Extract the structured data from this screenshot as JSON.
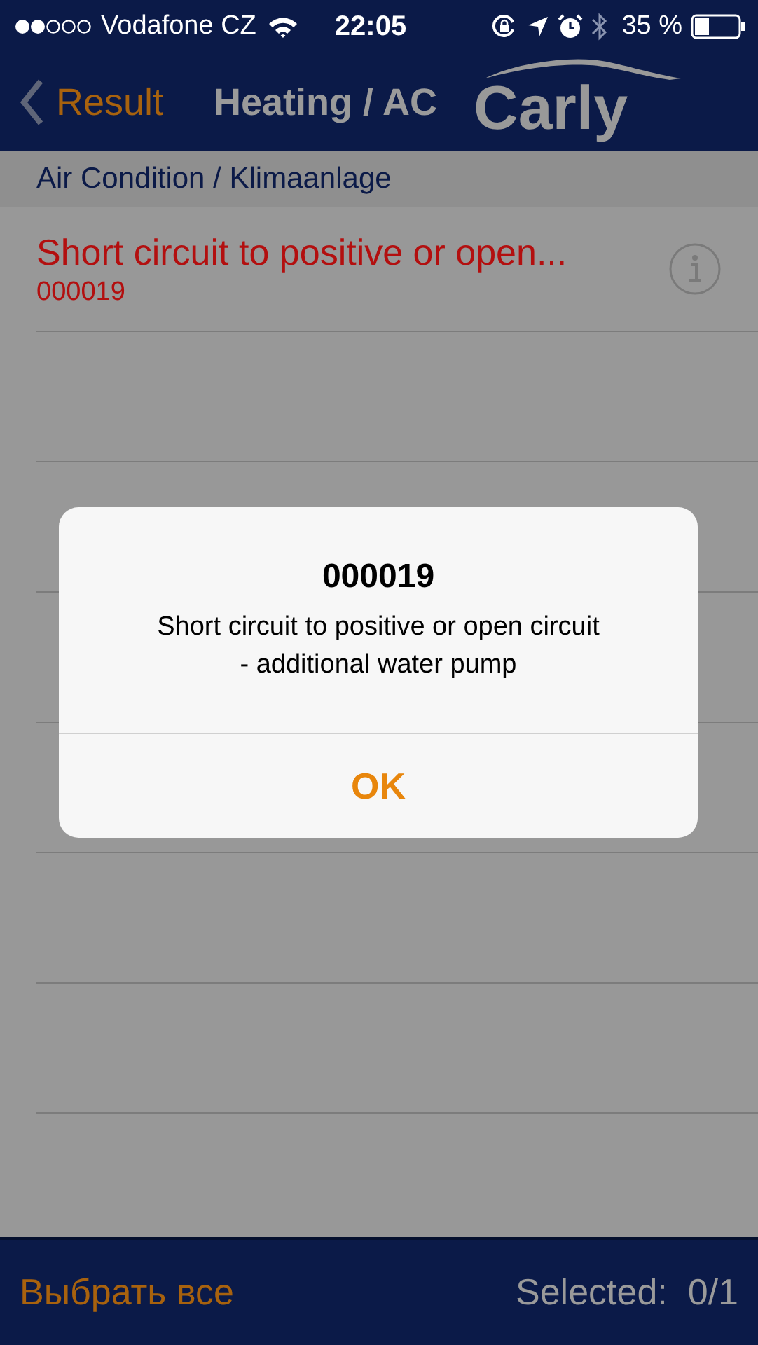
{
  "status_bar": {
    "carrier": "Vodafone CZ",
    "time": "22:05",
    "battery": "35 %"
  },
  "nav": {
    "back": "Result",
    "title": "Heating / AC",
    "logo": "Carly"
  },
  "section_header": "Air Condition / Klimaanlage",
  "rows": [
    {
      "title": "Short circuit to positive or open...",
      "code": "000019"
    }
  ],
  "dialog": {
    "title": "000019",
    "message": "Short circuit to positive or open circuit\n- additional water pump",
    "button": "OK"
  },
  "bottom_bar": {
    "select_all": "Выбрать все",
    "selected": "Selected:  0/1"
  }
}
